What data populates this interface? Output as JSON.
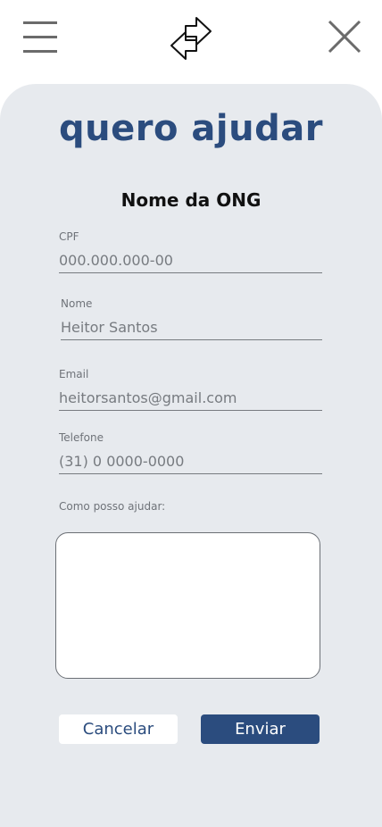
{
  "header": {
    "menu_icon": "hamburger-menu-icon",
    "logo_icon": "exchange-arrows-icon",
    "close_icon": "close-icon"
  },
  "page": {
    "title": "quero ajudar",
    "subtitle": "Nome da ONG"
  },
  "form": {
    "cpf": {
      "label": "CPF",
      "placeholder": "000.000.000-00"
    },
    "nome": {
      "label": "Nome",
      "placeholder": "Heitor Santos"
    },
    "email": {
      "label": "Email",
      "placeholder": "heitorsantos@gmail.com"
    },
    "telefone": {
      "label": "Telefone",
      "placeholder": "(31) 0 0000-0000"
    },
    "ajuda": {
      "label": "Como posso ajudar:"
    }
  },
  "actions": {
    "cancel_label": "Cancelar",
    "send_label": "Enviar"
  },
  "colors": {
    "brand": "#2b4c7e",
    "card_background": "#e7eaee"
  }
}
